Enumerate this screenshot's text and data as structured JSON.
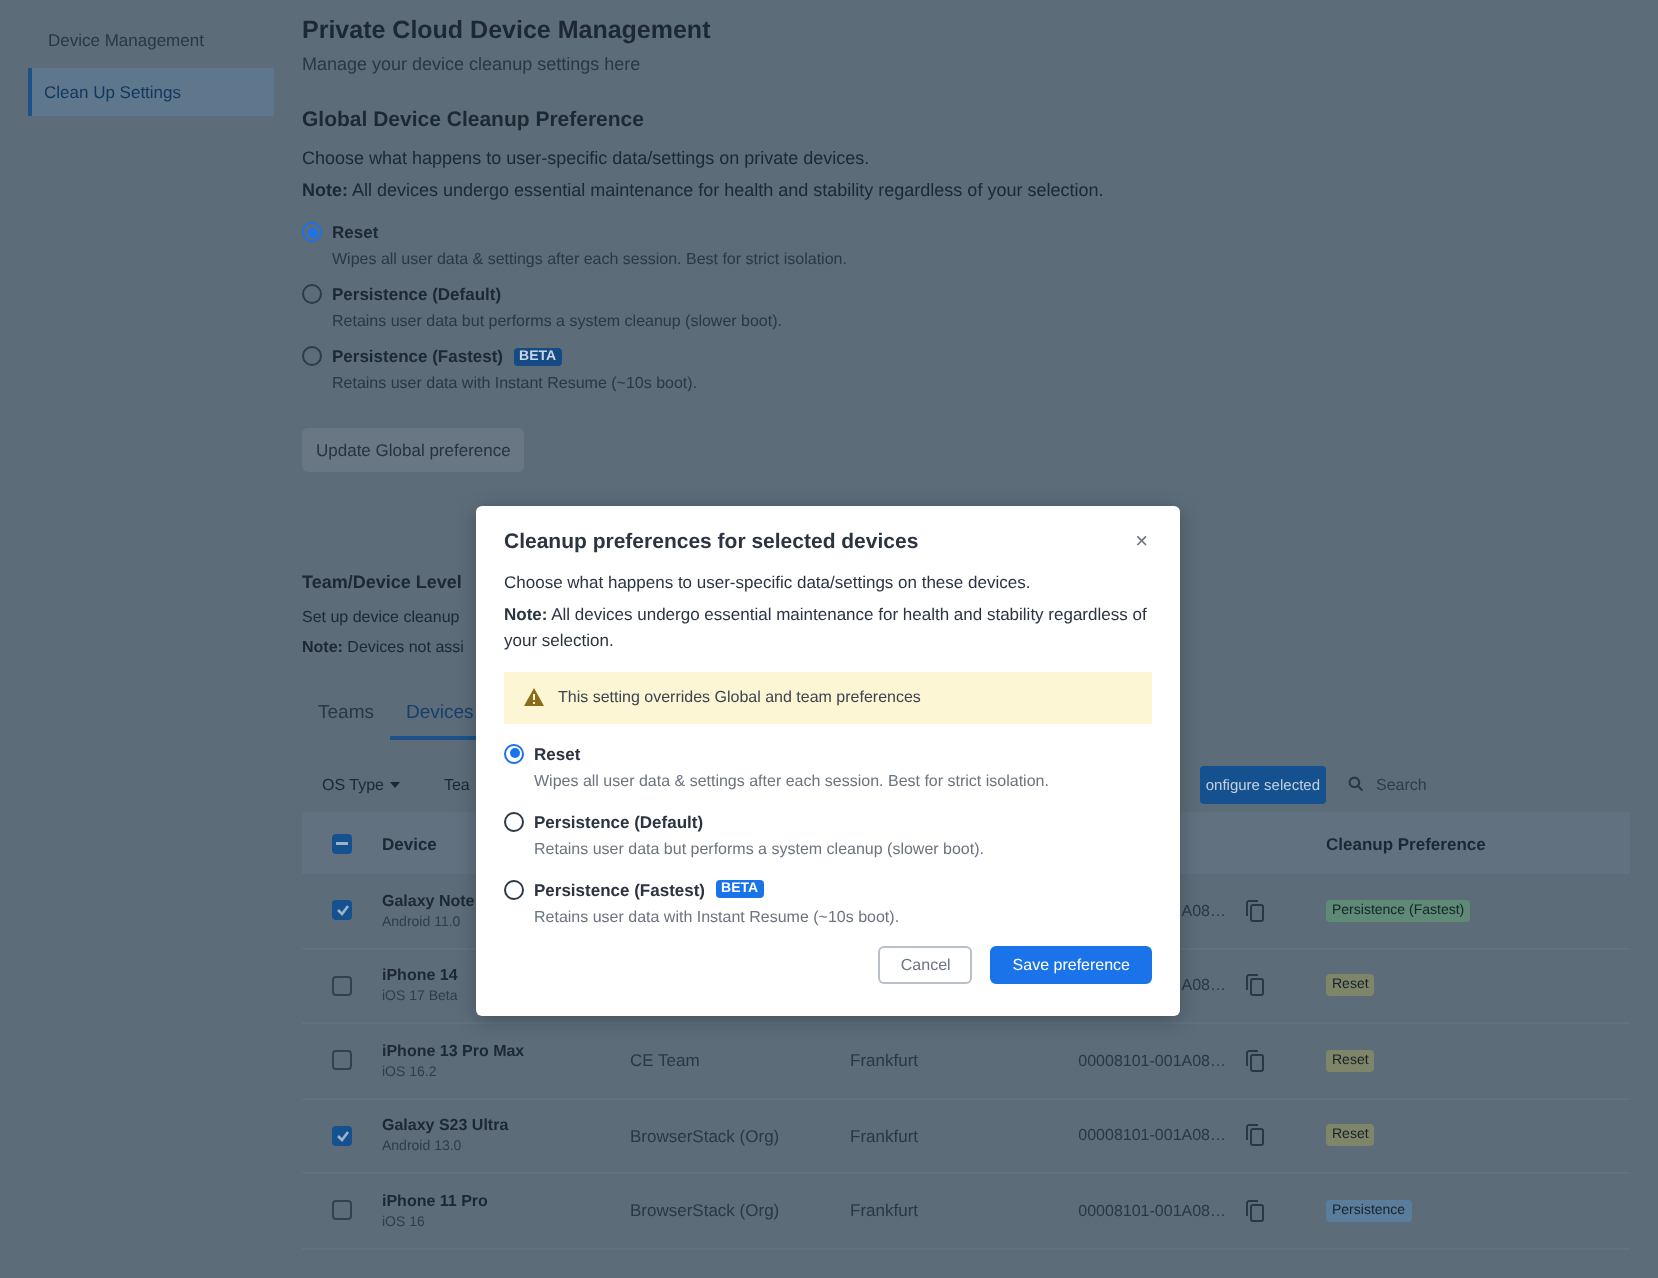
{
  "sidebar": {
    "items": [
      {
        "label": "Device Management",
        "selected": false
      },
      {
        "label": "Clean Up Settings",
        "selected": true
      }
    ]
  },
  "page": {
    "title": "Private Cloud Device Management",
    "subtitle": "Manage your device cleanup settings here"
  },
  "global": {
    "heading": "Global Device Cleanup Preference",
    "description": "Choose what happens to user-specific data/settings on private devices.",
    "note": "**Note:** All devices undergo essential maintenance for health and stability regardless of your selection.",
    "options": [
      {
        "label": "Reset",
        "hint": "Wipes all user data & settings after each session. Best for strict isolation.",
        "selected": true
      },
      {
        "label": "Persistence (Default)",
        "hint": "Retains user data but performs a system cleanup (slower boot).",
        "selected": false
      },
      {
        "label": "Persistence (Fastest)",
        "badge": "BETA",
        "hint": "Retains user data with Instant Resume (~10s boot).",
        "selected": false
      }
    ],
    "button": {
      "label": "Update Global preference",
      "disabled": true
    }
  },
  "team_level": {
    "heading": "Team/Device Level",
    "description": "Set up device cleanup",
    "note": "**Note:** Devices not assi",
    "tabs": [
      {
        "label": "Teams",
        "selected": false
      },
      {
        "label": "Devices",
        "selected": true
      }
    ],
    "filters": [
      {
        "label": "OS Type",
        "kind": "dropdown"
      },
      {
        "label": "Tea",
        "kind": "plain"
      }
    ],
    "configure_button": "onfigure selected",
    "search": {
      "placeholder": "Search"
    },
    "table": {
      "header_checkbox": {
        "indeterminate": true
      },
      "columns": [
        {
          "label": "Device"
        },
        {
          "label": "Cleanup Preference"
        }
      ],
      "rows": [
        {
          "checked": true,
          "device": "Galaxy Note",
          "os": "Android 11.0",
          "device_id": "A08…",
          "preference": {
            "label": "Persistence (Fastest)",
            "color": "#5e8a76"
          }
        },
        {
          "checked": false,
          "device": "iPhone 14",
          "os": "iOS 17 Beta",
          "device_id": "A08…",
          "preference": {
            "label": "Reset",
            "color": "#7f8568"
          }
        },
        {
          "checked": false,
          "device": "iPhone 13 Pro Max",
          "os": "iOS 16.2",
          "team": "CE Team",
          "location": "Frankfurt",
          "device_id": "00008101-001A08…",
          "preference": {
            "label": "Reset",
            "color": "#7f8568"
          }
        },
        {
          "checked": true,
          "device": "Galaxy S23 Ultra",
          "os": "Android 13.0",
          "team": "BrowserStack (Org)",
          "location": "Frankfurt",
          "device_id": "00008101-001A08…",
          "preference": {
            "label": "Reset",
            "color": "#7f8568"
          }
        },
        {
          "checked": false,
          "device": "iPhone 11 Pro",
          "os": "iOS 16",
          "team": "BrowserStack (Org)",
          "location": "Frankfurt",
          "device_id": "00008101-001A08…",
          "preference": {
            "label": "Persistence",
            "color": "#5b7d9c"
          }
        }
      ]
    }
  },
  "modal": {
    "title": "Cleanup preferences for selected devices",
    "close": "×",
    "description": "Choose what happens to user-specific data/settings on these devices.",
    "note": "**Note:** All devices undergo essential maintenance for health and stability regardless of your selection.",
    "warning": "This setting overrides Global and team preferences",
    "options": [
      {
        "label": "Reset",
        "hint": "Wipes all user data & settings after each session. Best for strict isolation.",
        "selected": true
      },
      {
        "label": "Persistence (Default)",
        "hint": "Retains user data but performs a system cleanup (slower boot).",
        "selected": false
      },
      {
        "label": "Persistence (Fastest)",
        "badge": "BETA",
        "hint": "Retains user data with Instant Resume (~10s boot).",
        "selected": false
      }
    ],
    "buttons": [
      {
        "label": "Cancel",
        "kind": "secondary"
      },
      {
        "label": "Save preference",
        "kind": "primary"
      }
    ]
  }
}
